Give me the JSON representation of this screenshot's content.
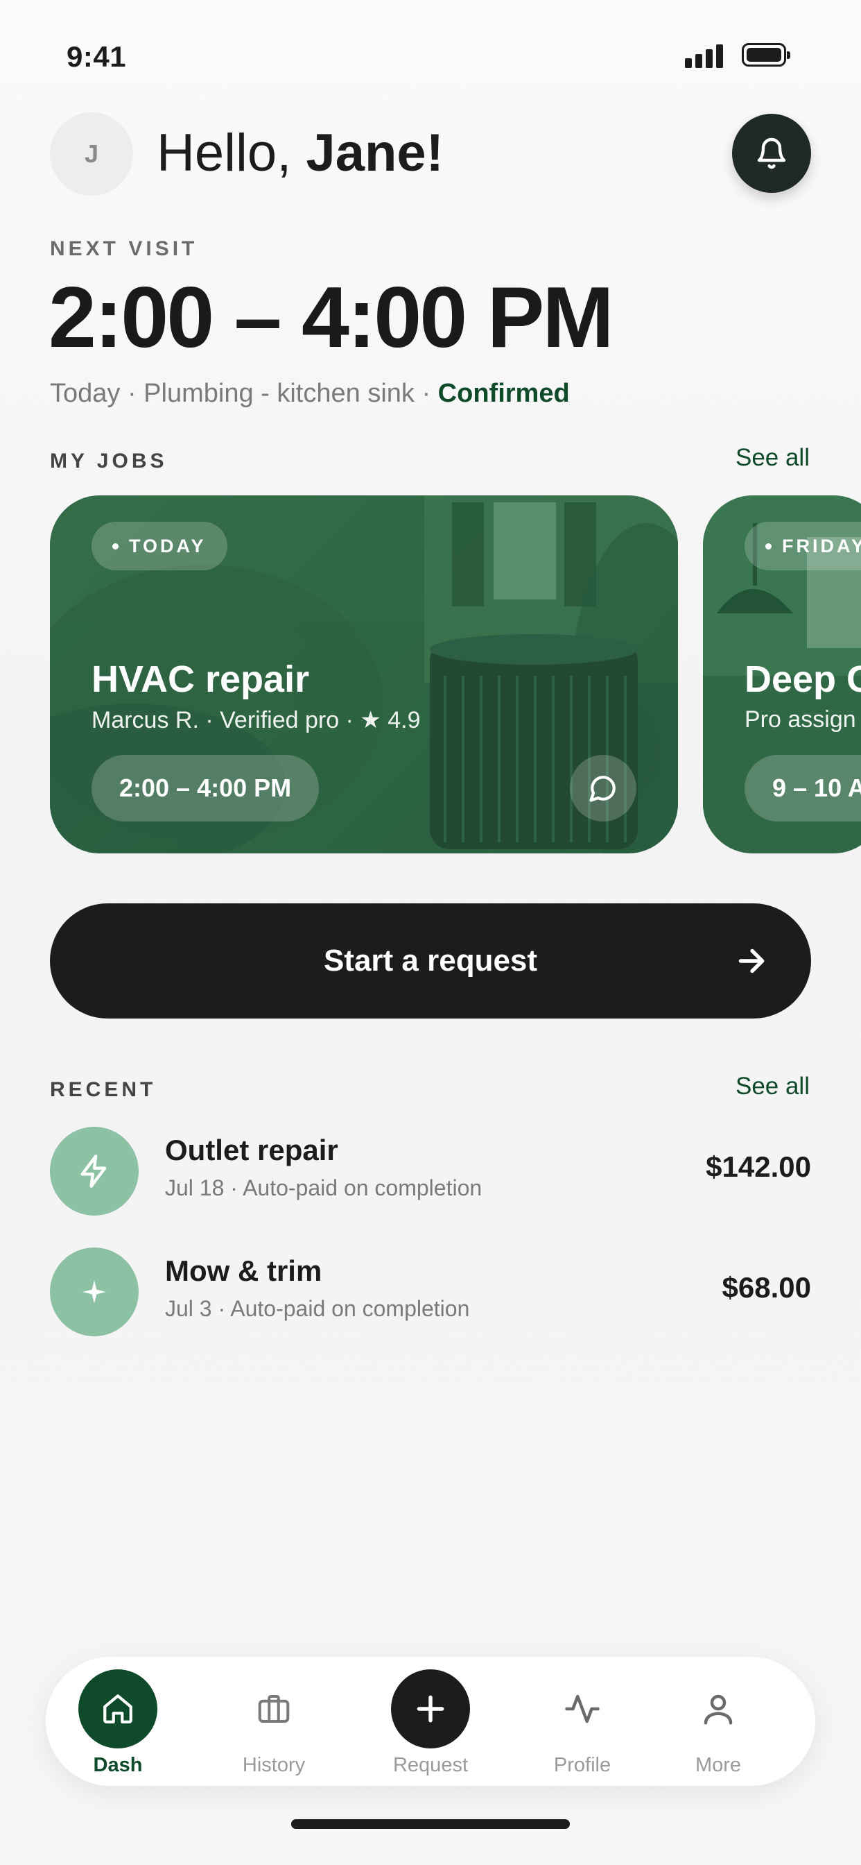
{
  "status_bar": {
    "time": "9:41"
  },
  "header": {
    "avatar_initial": "J",
    "greeting_prefix": "Hello, ",
    "greeting_name": "Jane!"
  },
  "next_visit": {
    "label": "NEXT VISIT",
    "time": "2:00 – 4:00 PM",
    "details": "Today · Plumbing - kitchen sink · ",
    "status": "Confirmed"
  },
  "my_jobs": {
    "label": "MY JOBS",
    "see_all": "See all",
    "cards": [
      {
        "tag": "TODAY",
        "title": "HVAC repair",
        "subtitle": "Marcus R. · Verified pro · ★ 4.9",
        "time": "2:00 – 4:00 PM"
      },
      {
        "tag": "FRIDAY",
        "title": "Deep C",
        "subtitle": "Pro assign",
        "time": "9 – 10 A"
      }
    ]
  },
  "cta": {
    "label": "Start a request"
  },
  "recent": {
    "label": "RECENT",
    "see_all": "See all",
    "items": [
      {
        "icon": "bolt-icon",
        "title": "Outlet repair",
        "meta": "Jul 18 · Auto-paid on completion",
        "amount": "$142.00"
      },
      {
        "icon": "sparkle-icon",
        "title": "Mow & trim",
        "meta": "Jul 3 · Auto-paid on completion",
        "amount": "$68.00"
      }
    ]
  },
  "tabbar": {
    "items": [
      {
        "label": "Dash",
        "icon": "home-icon",
        "active": true
      },
      {
        "label": "History",
        "icon": "briefcase-icon"
      },
      {
        "label": "Request",
        "icon": "plus-icon"
      },
      {
        "label": "Profile",
        "icon": "activity-icon"
      },
      {
        "label": "More",
        "icon": "user-icon"
      }
    ]
  },
  "colors": {
    "brand_green": "#0f4a2a",
    "accent_mint": "#8cc1a4",
    "dark": "#1c1c1c"
  }
}
